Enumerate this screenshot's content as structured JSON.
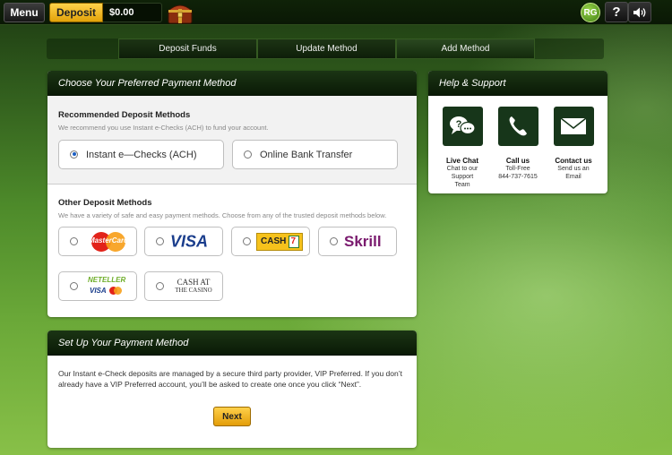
{
  "topbar": {
    "menu_label": "Menu",
    "deposit_label": "Deposit",
    "balance": "$0.00",
    "rg_label": "RG",
    "help_glyph": "?",
    "sound_icon": "speaker-icon",
    "chest_icon": "treasure-chest-icon"
  },
  "tabs": [
    {
      "label": "Deposit Funds"
    },
    {
      "label": "Update Method"
    },
    {
      "label": "Add Method"
    }
  ],
  "payment_panel": {
    "title": "Choose Your Preferred Payment Method",
    "recommended": {
      "title": "Recommended Deposit Methods",
      "subtitle": "We recommend you use Instant e-Checks (ACH) to fund your account.",
      "options": [
        {
          "label": "Instant e—Checks (ACH)",
          "selected": true
        },
        {
          "label": "Online Bank Transfer",
          "selected": false
        }
      ]
    },
    "other": {
      "title": "Other Deposit Methods",
      "subtitle": "We have a variety of safe and easy payment methods. Choose from any of the trusted deposit methods below.",
      "methods": [
        {
          "name": "MasterCard",
          "logo_text": "MasterCard"
        },
        {
          "name": "Visa",
          "logo_text": "VISA"
        },
        {
          "name": "7-Eleven Cash",
          "logo_text": "CASH"
        },
        {
          "name": "Skrill",
          "logo_text": "Skrill"
        },
        {
          "name": "Neteller Visa",
          "logo_text_1": "NETELLER",
          "logo_text_2": "VISA"
        },
        {
          "name": "Cash at the Casino",
          "logo_text_1": "CASH AT",
          "logo_text_2": "THE CASINO"
        }
      ]
    }
  },
  "help_panel": {
    "title": "Help & Support",
    "items": [
      {
        "title": "Live Chat",
        "line1": "Chat to our Support",
        "line2": "Team"
      },
      {
        "title": "Call us",
        "line1": "Toll-Free",
        "line2": "844-737-7615"
      },
      {
        "title": "Contact us",
        "line1": "Send us an",
        "line2": "Email"
      }
    ]
  },
  "setup_panel": {
    "title": "Set Up Your Payment Method",
    "body": "Our Instant e-Check deposits are managed by a secure third party provider, VIP Preferred. If you don’t already have a VIP Preferred account, you’ll be asked to create one once you click “Next”.",
    "next_label": "Next"
  },
  "colors": {
    "accent_gold": "#f3b41e",
    "header_green": "#0f2208",
    "selected_radio": "#1c5fc4"
  }
}
